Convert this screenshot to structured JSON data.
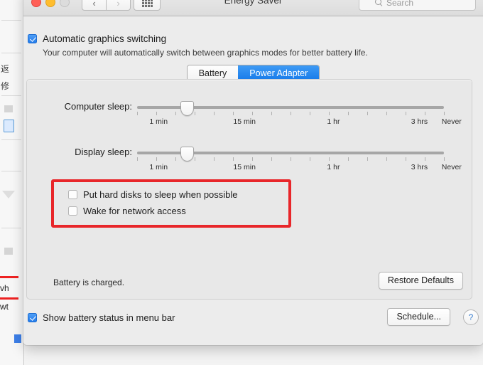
{
  "window": {
    "title": "Energy Saver",
    "traffic_lights": [
      "close",
      "minimize",
      "maximize"
    ],
    "nav_back": "‹",
    "nav_forward": "›",
    "grid_button_name": "show-all-preferences"
  },
  "search": {
    "placeholder": "Search"
  },
  "graphics": {
    "checkbox_label": "Automatic graphics switching",
    "checked": true,
    "description": "Your computer will automatically switch between graphics modes for better battery life."
  },
  "tabs": [
    {
      "label": "Battery",
      "active": false
    },
    {
      "label": "Power Adapter",
      "active": true
    }
  ],
  "sliders": [
    {
      "label": "Computer sleep:",
      "value_percent": 16,
      "tick_labels": [
        {
          "text": "1 min",
          "pos": 7
        },
        {
          "text": "15 min",
          "pos": 35
        },
        {
          "text": "1 hr",
          "pos": 64
        },
        {
          "text": "3 hrs",
          "pos": 92
        },
        {
          "text": "Never",
          "pos": 99
        }
      ]
    },
    {
      "label": "Display sleep:",
      "value_percent": 16,
      "tick_labels": [
        {
          "text": "1 min",
          "pos": 7
        },
        {
          "text": "15 min",
          "pos": 35
        },
        {
          "text": "1 hr",
          "pos": 64
        },
        {
          "text": "3 hrs",
          "pos": 92
        },
        {
          "text": "Never",
          "pos": 99
        }
      ]
    }
  ],
  "options": [
    {
      "label": "Put hard disks to sleep when possible",
      "checked": false
    },
    {
      "label": "Wake for network access",
      "checked": false
    }
  ],
  "highlight": {
    "color": "#e8262a"
  },
  "status": {
    "battery_text": "Battery is charged."
  },
  "buttons": {
    "restore_defaults": "Restore Defaults",
    "schedule": "Schedule...",
    "help": "?"
  },
  "footer": {
    "show_battery_label": "Show battery status in menu bar",
    "show_battery_checked": true
  },
  "background_window": {
    "cjk_1": "返",
    "cjk_2": "修",
    "frag_1": "vh",
    "frag_2": "wt"
  }
}
